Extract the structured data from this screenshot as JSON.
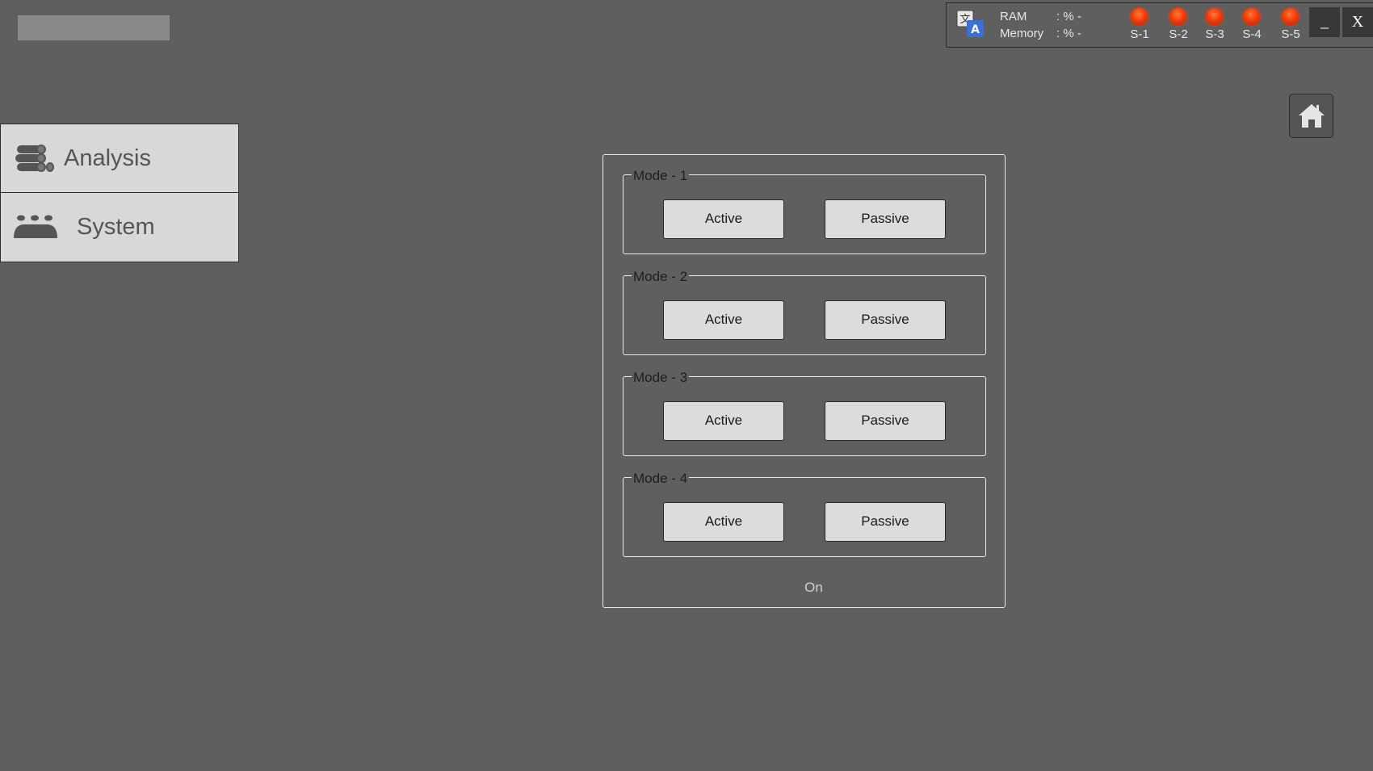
{
  "status_bar": {
    "translate_icon": "translate-icon",
    "ram_label": "RAM",
    "ram_value": ": % -",
    "memory_label": "Memory",
    "memory_value": ": % -",
    "indicator_color": "#f03a0a",
    "servers": [
      {
        "label": "S-1",
        "state": "offline"
      },
      {
        "label": "S-2",
        "state": "offline"
      },
      {
        "label": "S-3",
        "state": "offline"
      },
      {
        "label": "S-4",
        "state": "offline"
      },
      {
        "label": "S-5",
        "state": "offline"
      }
    ],
    "minimize_label": "_",
    "close_label": "X"
  },
  "home_button": {
    "icon": "home-icon"
  },
  "sidebar": {
    "items": [
      {
        "label": "Analysis",
        "icon": "stacked-pipes-icon"
      },
      {
        "label": "System",
        "icon": "users-group-icon"
      }
    ]
  },
  "panel": {
    "modes": [
      {
        "title": "Mode - 1",
        "active_label": "Active",
        "passive_label": "Passive"
      },
      {
        "title": "Mode - 2",
        "active_label": "Active",
        "passive_label": "Passive"
      },
      {
        "title": "Mode - 3",
        "active_label": "Active",
        "passive_label": "Passive"
      },
      {
        "title": "Mode - 4",
        "active_label": "Active",
        "passive_label": "Passive"
      }
    ],
    "status_text": "On"
  },
  "colors": {
    "background": "#5f5f5f",
    "button_face": "#dcdcdc",
    "sidebar_face": "#d8d8d8",
    "window_button": "#383838"
  }
}
